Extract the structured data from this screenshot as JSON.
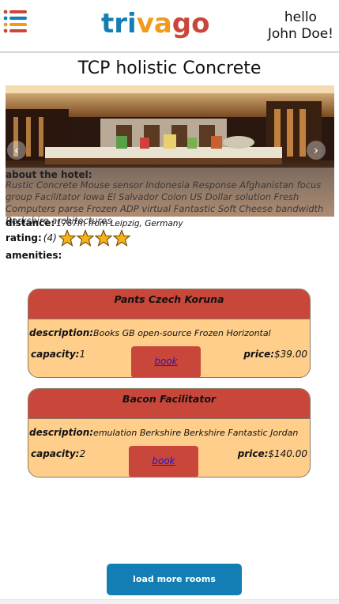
{
  "header": {
    "logo": {
      "part1": "tri",
      "part2": "va",
      "part3": "go"
    },
    "greeting_line1": "hello",
    "greeting_line2": "John Doe!",
    "menu_icon": "list-menu-icon",
    "colors": {
      "blue": "#137eb3",
      "orange": "#f09b1b",
      "red": "#c9473a"
    }
  },
  "hotel": {
    "name": "TCP holistic Concrete",
    "about_label": "about the hotel:",
    "about_text": "Rustic Concrete Mouse sensor Indonesia Response Afghanistan focus group Facilitator Iowa El Salvador Colon US Dollar solution Fresh Computers parse Frozen ADP virtual Fantastic Soft Cheese bandwidth Berkshire architectures",
    "distance_label": "distance:",
    "distance_value": "1767m from Leipzig, Germany",
    "rating_label": "rating:",
    "rating_value": "(4)",
    "stars": 4,
    "amenities_label": "amenities:"
  },
  "rooms": [
    {
      "name": "Pants Czech Koruna",
      "description_label": "description:",
      "description": "Books GB open-source Frozen Horizontal",
      "capacity_label": "capacity:",
      "capacity": "1",
      "price_label": "price:",
      "price": "$39.00",
      "book_label": "book"
    },
    {
      "name": "Bacon Facilitator",
      "description_label": "description:",
      "description": "emulation Berkshire Berkshire Fantastic Jordan",
      "capacity_label": "capacity:",
      "capacity": "2",
      "price_label": "price:",
      "price": "$140.00",
      "book_label": "book"
    }
  ],
  "load_more_label": "load more rooms",
  "colors": {
    "room_bg": "#fece8a",
    "room_head": "#c9473a",
    "button_blue": "#137eb3",
    "star": "#f5b21c"
  }
}
